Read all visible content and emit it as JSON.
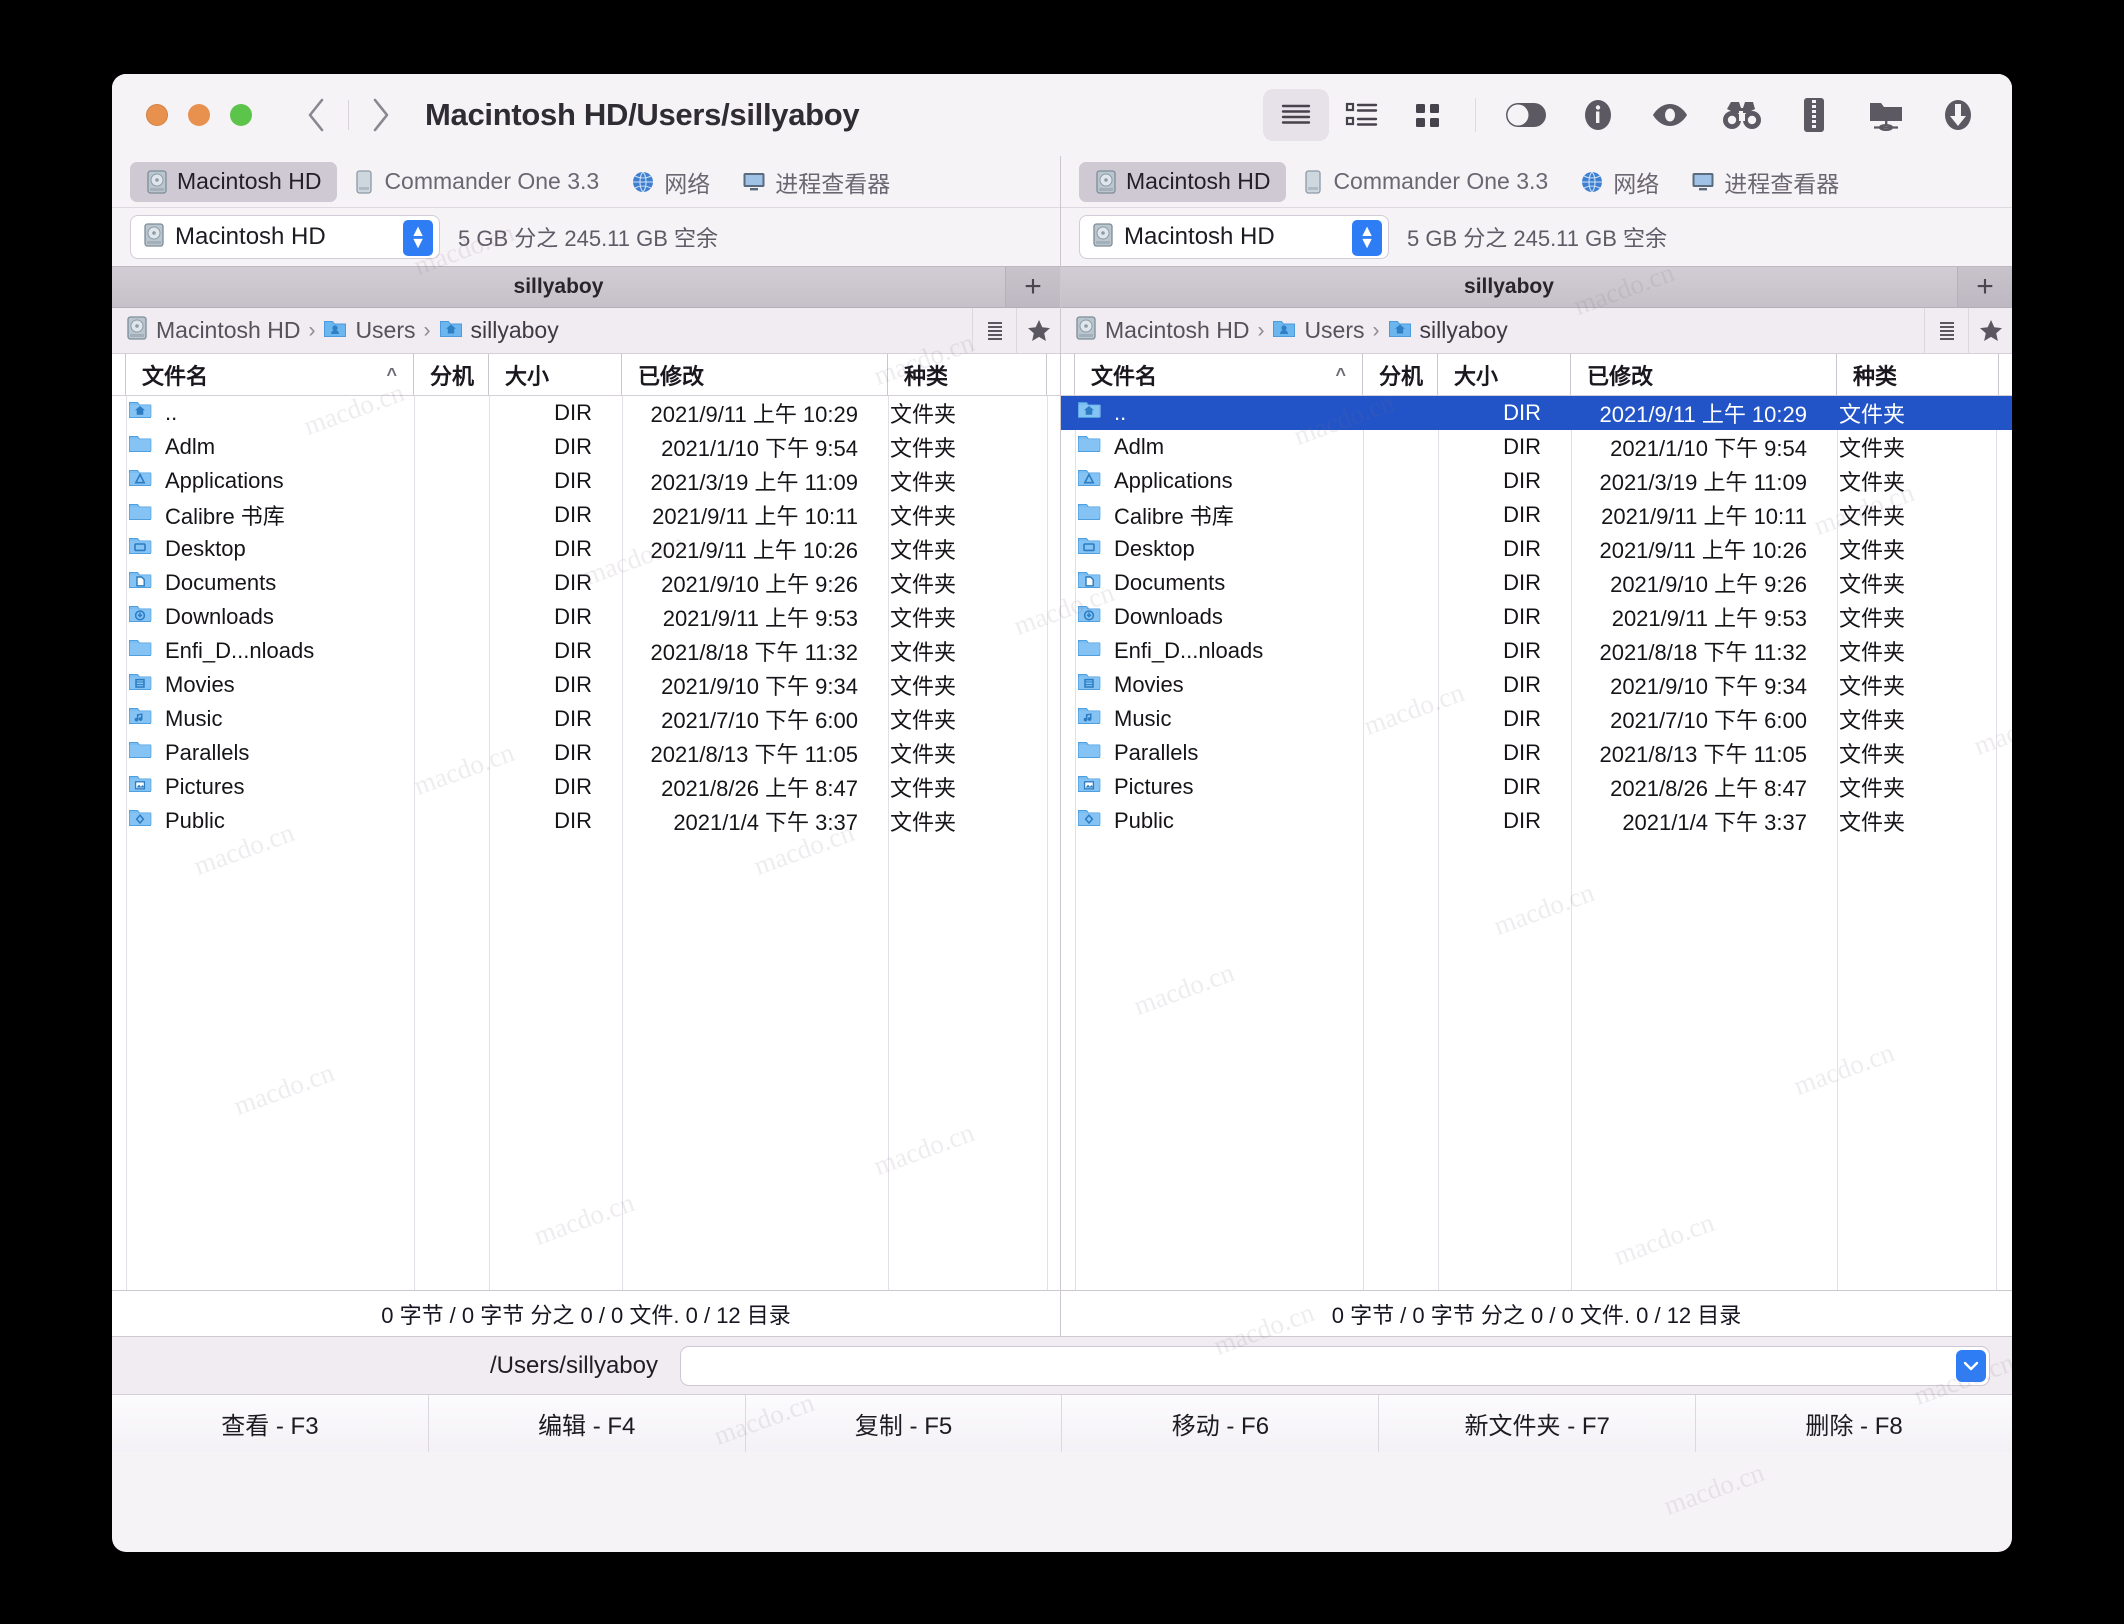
{
  "window": {
    "title": "Macintosh HD/Users/sillyaboy",
    "traffic_lights": [
      "#e8914f",
      "#e8914f",
      "#5cc44a"
    ],
    "nav": {
      "back_icon": "chevron-left-icon",
      "forward_icon": "chevron-right-icon"
    }
  },
  "toolbar": {
    "view_modes": [
      {
        "name": "brief-view",
        "icon": "list-lines-icon",
        "active": true
      },
      {
        "name": "full-view",
        "icon": "detail-list-icon",
        "active": false
      },
      {
        "name": "thumbnails-view",
        "icon": "grid-icon",
        "active": false
      }
    ],
    "actions": [
      {
        "name": "dual-pane-toggle",
        "icon": "toggle-switch-icon"
      },
      {
        "name": "info-button",
        "icon": "info-circle-icon"
      },
      {
        "name": "quick-look-button",
        "icon": "eye-icon"
      },
      {
        "name": "search-button",
        "icon": "binoculars-icon"
      },
      {
        "name": "archive-button",
        "icon": "zip-icon"
      },
      {
        "name": "network-folder-button",
        "icon": "network-folder-icon"
      },
      {
        "name": "download-button",
        "icon": "download-arrow-icon"
      }
    ]
  },
  "device_tabs": [
    {
      "label": "Macintosh HD",
      "icon": "hard-disk-icon",
      "active": true
    },
    {
      "label": "Commander One 3.3",
      "icon": "disk-icon",
      "active": false
    },
    {
      "label": "网络",
      "icon": "globe-icon",
      "active": false
    },
    {
      "label": "进程查看器",
      "icon": "monitor-icon",
      "active": false
    }
  ],
  "drive": {
    "name": "Macintosh HD",
    "icon": "hard-disk-icon",
    "free_space": "5 GB 分之 245.11 GB 空余",
    "stepper_up": "⌃",
    "stepper_down": "⌄"
  },
  "folder_tab": {
    "label": "sillyaboy",
    "add_label": "+"
  },
  "breadcrumb": {
    "items": [
      {
        "label": "Macintosh HD",
        "icon": "hard-disk-icon"
      },
      {
        "label": "Users",
        "icon": "users-folder-icon"
      },
      {
        "label": "sillyaboy",
        "icon": "home-folder-icon"
      }
    ],
    "separator": "›",
    "history_button": "history-list-icon",
    "favorite_button": "star-icon"
  },
  "columns": [
    {
      "key": "name",
      "label": "文件名",
      "sorted": true,
      "sort_arrow": "^"
    },
    {
      "key": "ext",
      "label": "分机"
    },
    {
      "key": "size",
      "label": "大小"
    },
    {
      "key": "modified",
      "label": "已修改"
    },
    {
      "key": "kind",
      "label": "种类"
    }
  ],
  "files": [
    {
      "name": "..",
      "icon": "home-folder-icon",
      "ext": "",
      "size": "DIR",
      "modified": "2021/9/11 上午 10:29",
      "kind": "文件夹"
    },
    {
      "name": "Adlm",
      "icon": "folder-icon",
      "ext": "",
      "size": "DIR",
      "modified": "2021/1/10 下午 9:54",
      "kind": "文件夹"
    },
    {
      "name": "Applications",
      "icon": "applications-folder-icon",
      "ext": "",
      "size": "DIR",
      "modified": "2021/3/19 上午 11:09",
      "kind": "文件夹"
    },
    {
      "name": "Calibre 书库",
      "icon": "folder-icon",
      "ext": "",
      "size": "DIR",
      "modified": "2021/9/11 上午 10:11",
      "kind": "文件夹"
    },
    {
      "name": "Desktop",
      "icon": "desktop-folder-icon",
      "ext": "",
      "size": "DIR",
      "modified": "2021/9/11 上午 10:26",
      "kind": "文件夹"
    },
    {
      "name": "Documents",
      "icon": "documents-folder-icon",
      "ext": "",
      "size": "DIR",
      "modified": "2021/9/10 上午 9:26",
      "kind": "文件夹"
    },
    {
      "name": "Downloads",
      "icon": "downloads-folder-icon",
      "ext": "",
      "size": "DIR",
      "modified": "2021/9/11 上午 9:53",
      "kind": "文件夹"
    },
    {
      "name": "Enfi_D...nloads",
      "icon": "folder-icon",
      "ext": "",
      "size": "DIR",
      "modified": "2021/8/18 下午 11:32",
      "kind": "文件夹"
    },
    {
      "name": "Movies",
      "icon": "movies-folder-icon",
      "ext": "",
      "size": "DIR",
      "modified": "2021/9/10 下午 9:34",
      "kind": "文件夹"
    },
    {
      "name": "Music",
      "icon": "music-folder-icon",
      "ext": "",
      "size": "DIR",
      "modified": "2021/7/10 下午 6:00",
      "kind": "文件夹"
    },
    {
      "name": "Parallels",
      "icon": "folder-icon",
      "ext": "",
      "size": "DIR",
      "modified": "2021/8/13 下午 11:05",
      "kind": "文件夹"
    },
    {
      "name": "Pictures",
      "icon": "pictures-folder-icon",
      "ext": "",
      "size": "DIR",
      "modified": "2021/8/26 上午 8:47",
      "kind": "文件夹"
    },
    {
      "name": "Public",
      "icon": "public-folder-icon",
      "ext": "",
      "size": "DIR",
      "modified": "2021/1/4 下午 3:37",
      "kind": "文件夹"
    }
  ],
  "selection": {
    "left_selected_index": -1,
    "right_selected_index": 0,
    "highlight_color": "#2254c8"
  },
  "pane_status": "0 字节 / 0 字节 分之 0 / 0 文件. 0 / 12 目录",
  "path_bar": {
    "label": "/Users/sillyaboy",
    "input_value": "",
    "dropdown_icon": "chevron-down-icon"
  },
  "function_keys": [
    {
      "label": "查看 - F3"
    },
    {
      "label": "编辑 - F4"
    },
    {
      "label": "复制 - F5"
    },
    {
      "label": "移动 - F6"
    },
    {
      "label": "新文件夹 - F7"
    },
    {
      "label": "删除 - F8"
    }
  ],
  "watermark": {
    "text": "macdo.cn"
  }
}
